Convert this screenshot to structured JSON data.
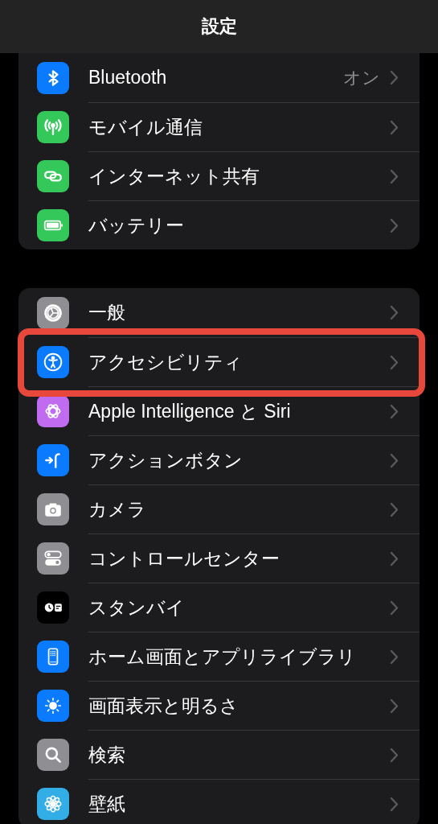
{
  "header": {
    "title": "設定"
  },
  "groups": [
    {
      "items": [
        {
          "label": "Bluetooth",
          "value": "オン",
          "highlighted": false
        },
        {
          "label": "モバイル通信",
          "highlighted": false
        },
        {
          "label": "インターネット共有",
          "highlighted": false
        },
        {
          "label": "バッテリー",
          "highlighted": false
        }
      ]
    },
    {
      "items": [
        {
          "label": "一般",
          "highlighted": false
        },
        {
          "label": "アクセシビリティ",
          "highlighted": true
        },
        {
          "label": "Apple Intelligence と Siri",
          "highlighted": false
        },
        {
          "label": "アクションボタン",
          "highlighted": false
        },
        {
          "label": "カメラ",
          "highlighted": false
        },
        {
          "label": "コントロールセンター",
          "highlighted": false
        },
        {
          "label": "スタンバイ",
          "highlighted": false
        },
        {
          "label": "ホーム画面とアプリライブラリ",
          "highlighted": false
        },
        {
          "label": "画面表示と明るさ",
          "highlighted": false
        },
        {
          "label": "検索",
          "highlighted": false
        },
        {
          "label": "壁紙",
          "highlighted": false
        }
      ]
    }
  ]
}
